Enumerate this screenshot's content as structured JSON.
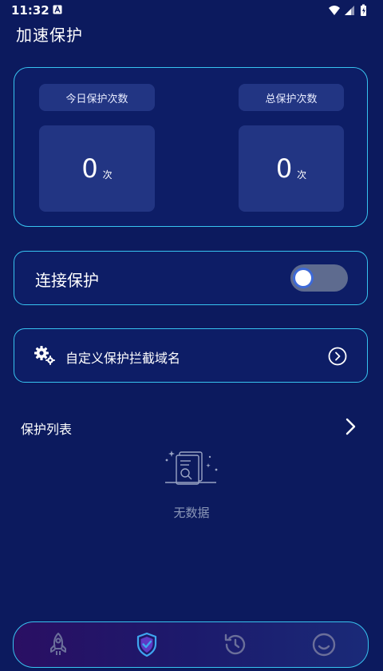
{
  "status_bar": {
    "time": "11:32",
    "notification_icon": "a-box-icon",
    "icons": [
      "wifi-icon",
      "signal-icon",
      "battery-icon"
    ]
  },
  "page": {
    "title": "加速保护"
  },
  "stats": {
    "today": {
      "label": "今日保护次数",
      "value": "0",
      "unit": "次"
    },
    "total": {
      "label": "总保护次数",
      "value": "0",
      "unit": "次"
    }
  },
  "connection_protection": {
    "label": "连接保护",
    "enabled": false
  },
  "custom_domains": {
    "label": "自定义保护拦截域名",
    "icon": "gears-icon",
    "action_icon": "chevron-circle-right-icon"
  },
  "protection_list": {
    "title": "保护列表",
    "empty_text": "无数据",
    "empty_icon": "document-search-icon"
  },
  "bottom_nav": {
    "items": [
      {
        "icon": "rocket-icon",
        "active": false
      },
      {
        "icon": "shield-check-icon",
        "active": true
      },
      {
        "icon": "history-icon",
        "active": false
      },
      {
        "icon": "smiley-icon",
        "active": false
      }
    ]
  },
  "colors": {
    "background": "#0c1a5e",
    "card_border": "#37c3f0",
    "card_inner": "#223583",
    "accent": "#3ea6f0",
    "muted_text": "#8c98b8",
    "nav_active": "#3ea6f0",
    "nav_inactive": "#6b6f9a"
  }
}
